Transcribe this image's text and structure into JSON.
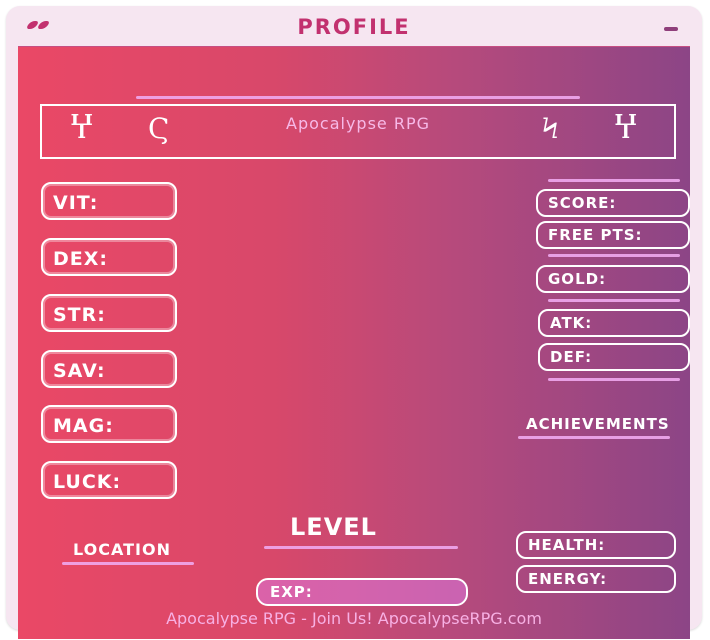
{
  "window": {
    "title": "PROFILE"
  },
  "banner": {
    "text": "Apocalypse RPG",
    "glyphs": [
      "ᱯ",
      "࿡",
      "࿢",
      "ᱯ"
    ]
  },
  "stats": {
    "vit": "VIT:",
    "dex": "DEX:",
    "str": "STR:",
    "sav": "SAV:",
    "mag": "MAG:",
    "luck": "LUCK:"
  },
  "right_stats": {
    "score": "SCORE:",
    "free_pts": "FREE PTS:",
    "gold": "GOLD:",
    "atk": "ATK:",
    "def": "DEF:"
  },
  "achievements": "ACHIEVEMENTS",
  "level": "LEVEL",
  "location": "LOCATION",
  "health": "HEALTH:",
  "energy": "ENERGY:",
  "exp": "EXP:",
  "footer": "Apocalypse RPG - Join Us! ApocalypseRPG.com",
  "colors": {
    "title": "#c2316f",
    "gradient_start": "#ea4866",
    "gradient_end": "#8c4586",
    "line": "#f0a9ee"
  }
}
